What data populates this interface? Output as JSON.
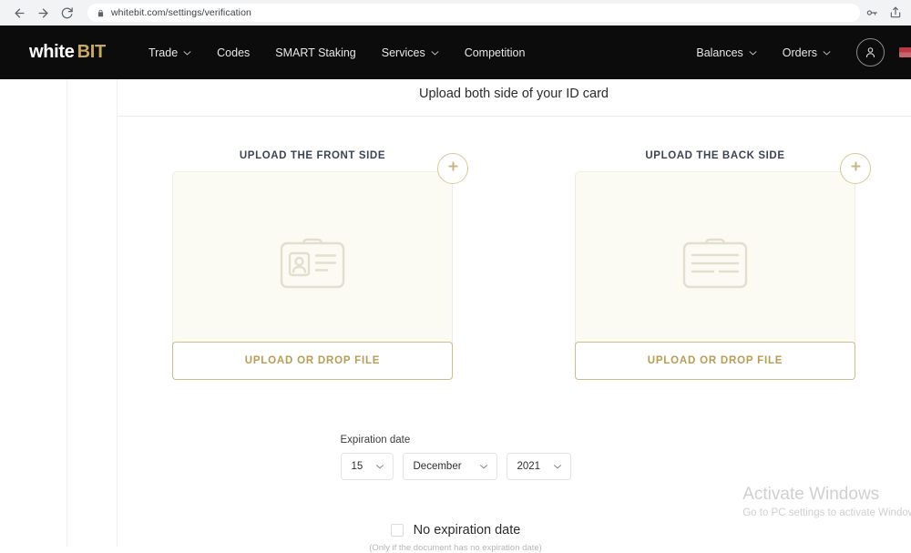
{
  "browser": {
    "url": "whitebit.com/settings/verification",
    "back_icon": "back-arrow-icon",
    "forward_icon": "forward-arrow-icon",
    "reload_icon": "reload-icon",
    "lock_icon": "lock-icon",
    "key_icon": "key-icon",
    "share_icon": "share-icon"
  },
  "header": {
    "logo_white": "white",
    "logo_gold": "BIT",
    "nav": [
      {
        "label": "Trade",
        "has_chevron": true
      },
      {
        "label": "Codes",
        "has_chevron": false
      },
      {
        "label": "SMART Staking",
        "has_chevron": false
      },
      {
        "label": "Services",
        "has_chevron": true
      },
      {
        "label": "Competition",
        "has_chevron": false
      }
    ],
    "right": [
      {
        "label": "Balances",
        "has_chevron": true
      },
      {
        "label": "Orders",
        "has_chevron": true
      }
    ],
    "avatar_icon": "user-avatar-icon",
    "flag_icon": "language-flag-icon"
  },
  "main": {
    "title": "Upload both side of your ID card",
    "uploads": [
      {
        "label": "UPLOAD THE FRONT SIDE",
        "button": "UPLOAD OR DROP FILE",
        "icon": "id-card-front-icon",
        "add_icon": "plus-circle-icon"
      },
      {
        "label": "UPLOAD THE BACK SIDE",
        "button": "UPLOAD OR DROP FILE",
        "icon": "id-card-back-icon",
        "add_icon": "plus-circle-icon"
      }
    ],
    "expiration": {
      "label": "Expiration date",
      "day": "15",
      "month": "December",
      "year": "2021"
    },
    "no_expiration": {
      "label": "No expiration date",
      "hint": "(Only if the document has no expiration date)",
      "checked": false
    }
  },
  "watermark": {
    "line1": "Activate Windows",
    "line2": "Go to PC settings to activate Windows."
  },
  "colors": {
    "header_bg": "#0c0c0c",
    "gold": "#c9a961",
    "dropzone_bg": "#fbfbf3",
    "button_border": "#cdbd8e"
  }
}
